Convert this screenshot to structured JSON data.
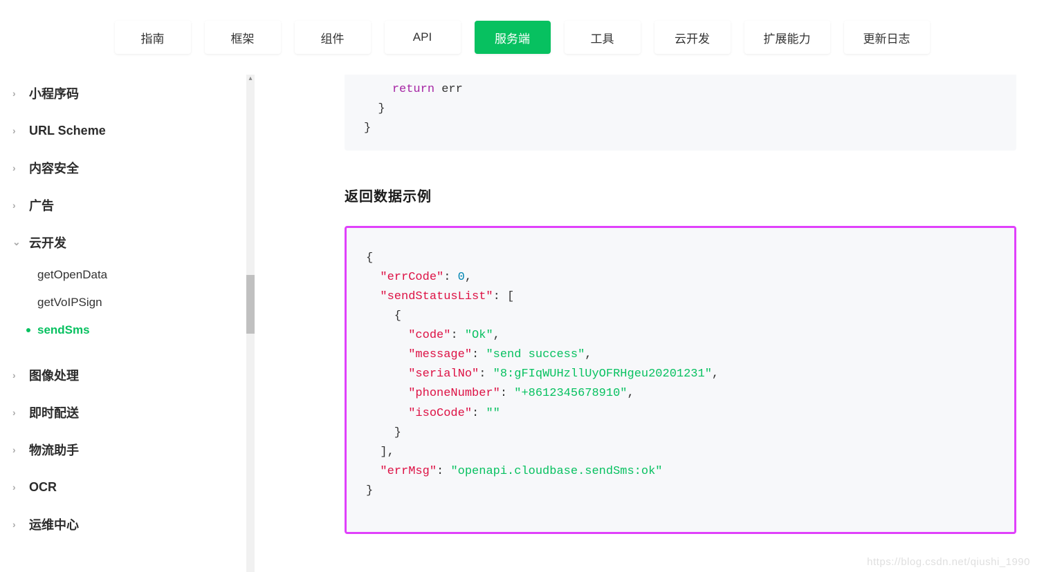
{
  "nav": {
    "items": [
      {
        "label": "指南",
        "active": false
      },
      {
        "label": "框架",
        "active": false
      },
      {
        "label": "组件",
        "active": false
      },
      {
        "label": "API",
        "active": false
      },
      {
        "label": "服务端",
        "active": true
      },
      {
        "label": "工具",
        "active": false
      },
      {
        "label": "云开发",
        "active": false
      },
      {
        "label": "扩展能力",
        "active": false
      },
      {
        "label": "更新日志",
        "active": false
      }
    ]
  },
  "sidebar": {
    "groups": [
      {
        "label": "小程序码",
        "expanded": false
      },
      {
        "label": "URL Scheme",
        "expanded": false
      },
      {
        "label": "内容安全",
        "expanded": false
      },
      {
        "label": "广告",
        "expanded": false
      },
      {
        "label": "云开发",
        "expanded": true,
        "children": [
          {
            "label": "getOpenData",
            "active": false
          },
          {
            "label": "getVoIPSign",
            "active": false
          },
          {
            "label": "sendSms",
            "active": true
          }
        ]
      },
      {
        "label": "图像处理",
        "expanded": false
      },
      {
        "label": "即时配送",
        "expanded": false
      },
      {
        "label": "物流助手",
        "expanded": false
      },
      {
        "label": "OCR",
        "expanded": false
      },
      {
        "label": "运维中心",
        "expanded": false
      }
    ]
  },
  "content": {
    "snippet1": {
      "kw_return": "return",
      "var_err": "err"
    },
    "section_title": "返回数据示例",
    "json_example": {
      "k_errCode": "\"errCode\"",
      "v_errCode": "0",
      "k_sendStatusList": "\"sendStatusList\"",
      "k_code": "\"code\"",
      "v_code": "\"Ok\"",
      "k_message": "\"message\"",
      "v_message": "\"send success\"",
      "k_serialNo": "\"serialNo\"",
      "v_serialNo": "\"8:gFIqWUHzllUyOFRHgeu20201231\"",
      "k_phoneNumber": "\"phoneNumber\"",
      "v_phoneNumber": "\"+8612345678910\"",
      "k_isoCode": "\"isoCode\"",
      "v_isoCode": "\"\"",
      "k_errMsg": "\"errMsg\"",
      "v_errMsg": "\"openapi.cloudbase.sendSms:ok\""
    }
  },
  "watermark": "https://blog.csdn.net/qiushi_1990"
}
